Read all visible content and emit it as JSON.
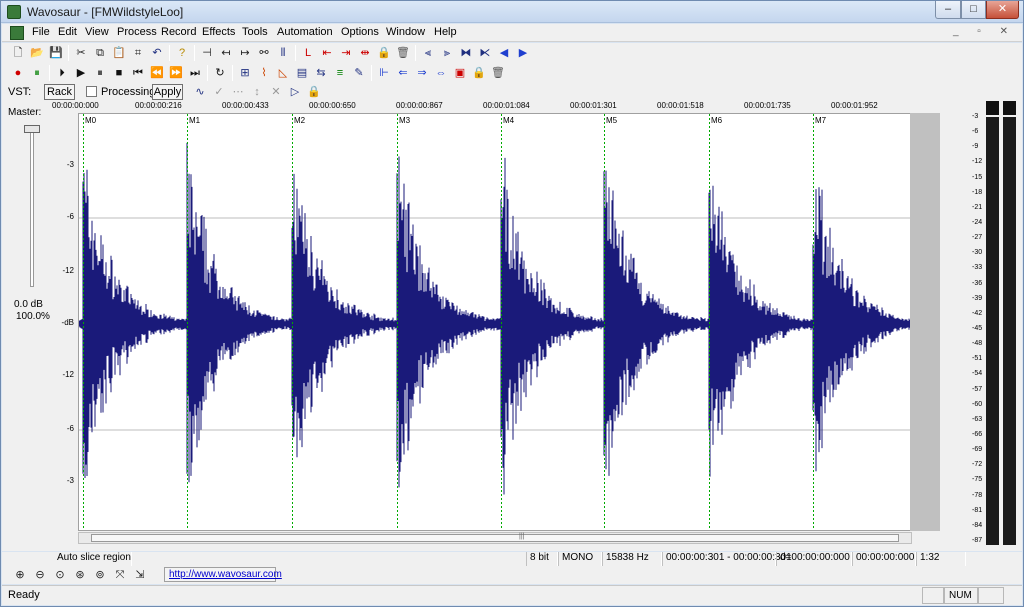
{
  "window": {
    "title": "Wavosaur - [FMWildstyleLoo]",
    "min_glyph": "–",
    "max_glyph": "□",
    "close_glyph": "✕"
  },
  "menu": {
    "items": [
      "File",
      "Edit",
      "View",
      "Process",
      "Record",
      "Effects",
      "Tools",
      "Automation",
      "Options",
      "Window",
      "Help"
    ],
    "mdi_glyphs": "_ ▫ ✕"
  },
  "toolbar1": {
    "icons": [
      {
        "name": "new-file-icon",
        "glyph": "🗋",
        "color": "#222"
      },
      {
        "name": "open-folder-icon",
        "glyph": "📂",
        "color": "#b88a00"
      },
      {
        "name": "save-icon",
        "glyph": "💾",
        "color": "#203080"
      },
      {
        "name": "cut-icon",
        "glyph": "✂",
        "color": "#222"
      },
      {
        "name": "copy-icon",
        "glyph": "⧉",
        "color": "#222"
      },
      {
        "name": "paste-icon",
        "glyph": "📋",
        "color": "#222"
      },
      {
        "name": "crop-icon",
        "glyph": "⌗",
        "color": "#222"
      },
      {
        "name": "undo-icon",
        "glyph": "↶",
        "color": "#203080"
      },
      {
        "name": "help-icon",
        "glyph": "?",
        "color": "#b88a00"
      },
      {
        "name": "marker-icon",
        "glyph": "⊣",
        "color": "#222"
      },
      {
        "name": "nudge-left-icon",
        "glyph": "↤",
        "color": "#222"
      },
      {
        "name": "nudge-right-icon",
        "glyph": "↦",
        "color": "#222"
      },
      {
        "name": "link-icon",
        "glyph": "⚯",
        "color": "#222"
      },
      {
        "name": "region-icon",
        "glyph": "⫴",
        "color": "#203080"
      },
      {
        "name": "marker-red-icon",
        "glyph": "L",
        "color": "#cc0000"
      },
      {
        "name": "marker-prev-icon",
        "glyph": "⇤",
        "color": "#cc0000"
      },
      {
        "name": "marker-next-icon",
        "glyph": "⇥",
        "color": "#cc0000"
      },
      {
        "name": "marker-delete-icon",
        "glyph": "⇹",
        "color": "#cc0000"
      },
      {
        "name": "lock-icon",
        "glyph": "🔒",
        "color": "#b88a00"
      },
      {
        "name": "trash-icon",
        "glyph": "🗑",
        "color": "#555"
      },
      {
        "name": "slice-icon",
        "glyph": "⫷",
        "color": "#203080"
      },
      {
        "name": "slice-a-icon",
        "glyph": "⫸",
        "color": "#203080"
      },
      {
        "name": "slice-b-icon",
        "glyph": "⧓",
        "color": "#203080"
      },
      {
        "name": "slice-c-icon",
        "glyph": "⧔",
        "color": "#203080"
      },
      {
        "name": "prev-slice-icon",
        "glyph": "◀",
        "color": "#1f3fcf"
      },
      {
        "name": "next-slice-icon",
        "glyph": "▶",
        "color": "#1f3fcf"
      }
    ]
  },
  "toolbar2": {
    "icons": [
      {
        "name": "record-icon",
        "glyph": "●",
        "color": "#d00000"
      },
      {
        "name": "record-pause-icon",
        "glyph": "⏸",
        "color": "#008000"
      },
      {
        "name": "play-from-start-icon",
        "glyph": "⏵",
        "color": "#111"
      },
      {
        "name": "play-icon",
        "glyph": "▶",
        "color": "#111"
      },
      {
        "name": "pause-icon",
        "glyph": "⏸",
        "color": "#111"
      },
      {
        "name": "stop-icon",
        "glyph": "■",
        "color": "#111"
      },
      {
        "name": "go-start-icon",
        "glyph": "⏮",
        "color": "#111"
      },
      {
        "name": "rewind-icon",
        "glyph": "⏪",
        "color": "#111"
      },
      {
        "name": "fast-forward-icon",
        "glyph": "⏩",
        "color": "#111"
      },
      {
        "name": "go-end-icon",
        "glyph": "⏭",
        "color": "#111"
      },
      {
        "name": "loop-icon",
        "glyph": "↻",
        "color": "#111"
      },
      {
        "name": "normalize-icon",
        "glyph": "⊞",
        "color": "#203080"
      },
      {
        "name": "envelope-icon",
        "glyph": "⌇",
        "color": "#cc4400"
      },
      {
        "name": "fade-icon",
        "glyph": "◺",
        "color": "#cc4400"
      },
      {
        "name": "eq-icon",
        "glyph": "▤",
        "color": "#203080"
      },
      {
        "name": "reverse-icon",
        "glyph": "⇆",
        "color": "#203080"
      },
      {
        "name": "gain-icon",
        "glyph": "≡",
        "color": "#008000"
      },
      {
        "name": "pencil-icon",
        "glyph": "✎",
        "color": "#203080"
      },
      {
        "name": "region-start-icon",
        "glyph": "⊩",
        "color": "#1f3fcf"
      },
      {
        "name": "region-prev-icon",
        "glyph": "⇐",
        "color": "#1f3fcf"
      },
      {
        "name": "region-next-icon",
        "glyph": "⇒",
        "color": "#1f3fcf"
      },
      {
        "name": "region-move-icon",
        "glyph": "⇔",
        "color": "#1f3fcf"
      },
      {
        "name": "region-select-icon",
        "glyph": "▣",
        "color": "#cc0000"
      },
      {
        "name": "region-lock-icon",
        "glyph": "🔒",
        "color": "#b88a00"
      },
      {
        "name": "region-trash-icon",
        "glyph": "🗑",
        "color": "#555"
      }
    ]
  },
  "vst": {
    "label": "VST:",
    "rack_label": "Rack",
    "processing_label": "Processing",
    "apply_label": "Apply",
    "icons": [
      {
        "name": "vst-wave-icon",
        "glyph": "∿",
        "color": "#203080"
      },
      {
        "name": "vst-check-icon",
        "glyph": "✓",
        "color": "#999"
      },
      {
        "name": "vst-dots-icon",
        "glyph": "⋯",
        "color": "#999"
      },
      {
        "name": "vst-updown-icon",
        "glyph": "↕",
        "color": "#999"
      },
      {
        "name": "vst-x-icon",
        "glyph": "✕",
        "color": "#999"
      },
      {
        "name": "vst-play-icon",
        "glyph": "▷",
        "color": "#203080"
      },
      {
        "name": "vst-lock-icon",
        "glyph": "🔒",
        "color": "#b88a00"
      }
    ]
  },
  "master": {
    "label": "Master:",
    "db": "0.0 dB",
    "percent": "100.0%"
  },
  "timeline": {
    "ticks": [
      "00:00:00:000",
      "00:00:00:216",
      "00:00:00:433",
      "00:00:00:650",
      "00:00:00:867",
      "00:00:01:084",
      "00:00:01:301",
      "00:00:01:518",
      "00:00:01:735",
      "00:00:01:952"
    ]
  },
  "markers": [
    "M0",
    "M1",
    "M2",
    "M3",
    "M4",
    "M5",
    "M6",
    "M7"
  ],
  "amplitude_labels": [
    "-3",
    "-6",
    "-12",
    "-dB",
    "-12",
    "-6",
    "-3"
  ],
  "meter_scale": [
    "-3",
    "-6",
    "-9",
    "-12",
    "-15",
    "-18",
    "-21",
    "-24",
    "-27",
    "-30",
    "-33",
    "-36",
    "-39",
    "-42",
    "-45",
    "-48",
    "-51",
    "-54",
    "-57",
    "-60",
    "-63",
    "-66",
    "-69",
    "-72",
    "-75",
    "-78",
    "-81",
    "-84",
    "-87"
  ],
  "info": {
    "slice_region": "Auto slice region",
    "bits": "8 bit",
    "channels": "MONO",
    "rate": "15838 Hz",
    "selection": "00:00:00:301 - 00:00:00:301",
    "duration": "d=00:00:00:000",
    "cursor": "00:00:00:000",
    "zoom": "1:32"
  },
  "bottom": {
    "url": "http://www.wavosaur.com",
    "icons": [
      {
        "name": "zoom-in-icon",
        "glyph": "⊕"
      },
      {
        "name": "zoom-out-icon",
        "glyph": "⊖"
      },
      {
        "name": "zoom-full-icon",
        "glyph": "⊙"
      },
      {
        "name": "zoom-selection-icon",
        "glyph": "⊛"
      },
      {
        "name": "zoom-vertical-icon",
        "glyph": "⊚"
      },
      {
        "name": "fit-icon",
        "glyph": "⤧"
      },
      {
        "name": "snap-icon",
        "glyph": "⇲"
      }
    ]
  },
  "status": {
    "text": "Ready",
    "num": "NUM"
  },
  "colors": {
    "waveform": "#1a1a7a",
    "marker_line": "#00aa00",
    "grid_line": "#7a7a7a"
  }
}
